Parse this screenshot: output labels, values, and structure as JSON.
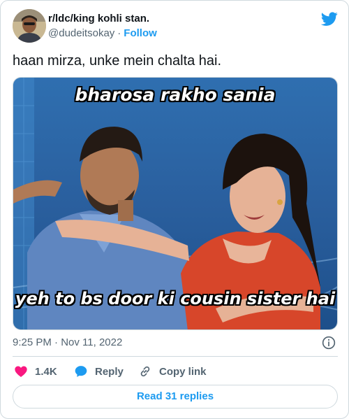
{
  "author": {
    "display_name": "r/ldc/king kohli stan.",
    "handle": "@dudeitsokay",
    "separator": "·",
    "follow_label": "Follow"
  },
  "tweet": {
    "text": "haan mirza, unke mein chalta hai.",
    "timestamp": "9:25 PM · Nov 11, 2022"
  },
  "media": {
    "caption_top": "bharosa rakho sania",
    "caption_bottom": "yeh to bs door ki cousin sister hai"
  },
  "actions": {
    "like_count": "1.4K",
    "reply_label": "Reply",
    "copy_label": "Copy link"
  },
  "footer": {
    "read_replies_label": "Read 31 replies"
  },
  "colors": {
    "accent": "#1d9bf0",
    "like": "#f91880",
    "secondary_text": "#536471",
    "border": "#cfd9de"
  },
  "icons": {
    "brand": "twitter-bird-icon",
    "info": "info-icon",
    "like": "heart-icon",
    "reply": "speech-bubble-icon",
    "copy": "link-icon"
  }
}
